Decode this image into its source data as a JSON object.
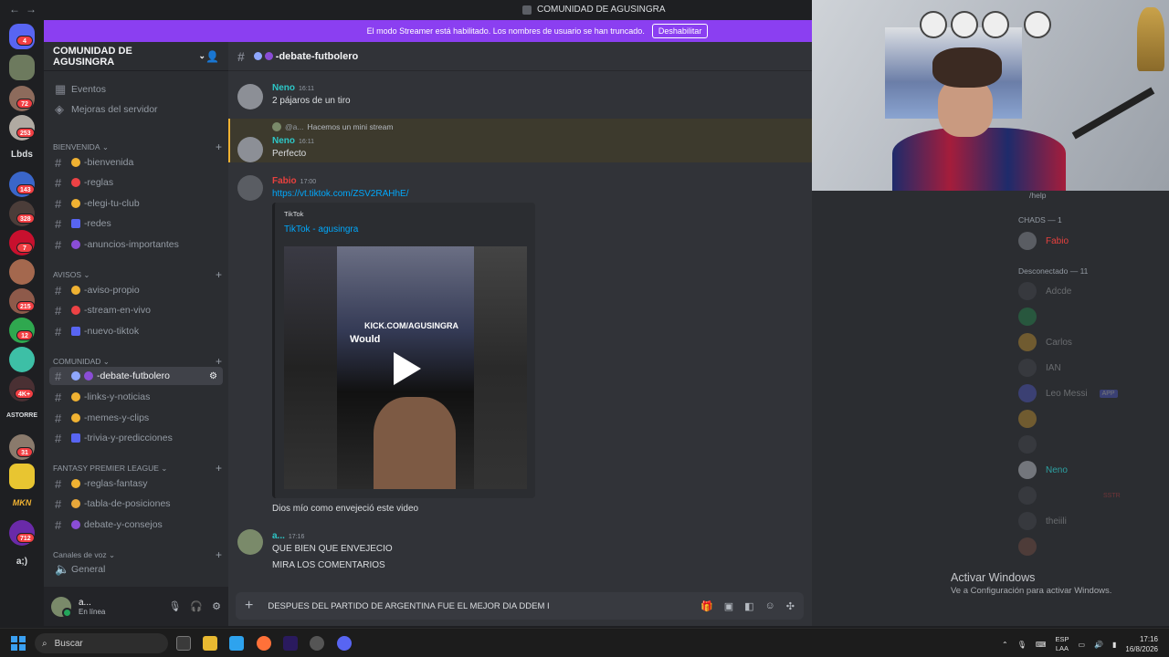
{
  "window": {
    "title": "COMUNIDAD DE AGUSINGRA"
  },
  "banner": {
    "text": "El modo Streamer está habilitado. Los nombres de usuario se han truncado.",
    "button": "Deshabilitar"
  },
  "guilds": {
    "badges": [
      "4",
      "72",
      "253",
      "143",
      "328",
      "7",
      "215",
      "12",
      "4K+",
      "31",
      "712"
    ],
    "labels": {
      "lbds": "Lbds",
      "astorre": "ASTORRE",
      "mkn": "MKN",
      "smile": "a;)"
    }
  },
  "server": {
    "name": "COMUNIDAD DE AGUSINGRA"
  },
  "sidebar": {
    "top": [
      "Eventos",
      "Mejoras del servidor"
    ],
    "categories": [
      "BIENVENIDA",
      "AVISOS",
      "COMUNIDAD",
      "FANTASY PREMIER LEAGUE",
      "Canales de voz"
    ],
    "channels": {
      "bienvenida": [
        "-bienvenida",
        "-reglas",
        "-elegi-tu-club",
        "-redes",
        "-anuncios-importantes"
      ],
      "avisos": [
        "-aviso-propio",
        "-stream-en-vivo",
        "-nuevo-tiktok"
      ],
      "comunidad": [
        "-debate-futbolero",
        "-links-y-noticias",
        "-memes-y-clips",
        "-trivia-y-predicciones"
      ],
      "fantasy": [
        "-reglas-fantasy",
        "-tabla-de-posiciones",
        "debate-y-consejos"
      ],
      "voz": [
        "General"
      ]
    }
  },
  "user": {
    "name": "a...",
    "status": "En línea"
  },
  "channel": {
    "name": "-debate-futbolero"
  },
  "messages": [
    {
      "author": "Neno",
      "time": "16:11",
      "text": "2 pájaros de un tiro"
    },
    {
      "reply_author": "@a...",
      "reply_text": "Hacemos un mini stream",
      "author": "Neno",
      "time": "16:11",
      "text": "Perfecto"
    },
    {
      "author": "Fabio",
      "time": "17:00",
      "link": "https://vt.tiktok.com/ZSV2RAHhE/",
      "embed_provider": "TikTok",
      "embed_title": "TikTok - agusingra",
      "video_kick": "KICK.COM/AGUSINGRA",
      "video_would": "Would",
      "text": "Dios mío como envejeció este video"
    },
    {
      "author": "a...",
      "time": "17:16",
      "text": "QUE BIEN QUE ENVEJECIO",
      "text2": "MIRA LOS COMENTARIOS"
    }
  ],
  "composer": {
    "value": "DESPUES DEL PARTIDO DE ARGENTINA FUE EL MEJOR DIA DDEM I"
  },
  "members": {
    "help": "/help",
    "chads_header": "CHADS — 1",
    "chads": [
      "Fabio"
    ],
    "offline_header": "Desconectado — 11",
    "offline": [
      "Adcde",
      "Carlos",
      "IAN",
      "Leo Messi",
      "Neno",
      "theiili"
    ],
    "app_tag": "APP",
    "sstr_tag": "SSTR"
  },
  "activate": {
    "line1": "Activar Windows",
    "line2": "Ve a Configuración para activar Windows."
  },
  "taskbar": {
    "search": "Buscar",
    "lang1": "ESP",
    "lang2": "LAA",
    "time": "17:16",
    "date": "16/8/2026"
  },
  "colors": {
    "accent": "#5865f2",
    "banner": "#8b3ff1",
    "link": "#00a8fc",
    "neno": "#2dc7c7",
    "fabio": "#e8413e"
  }
}
